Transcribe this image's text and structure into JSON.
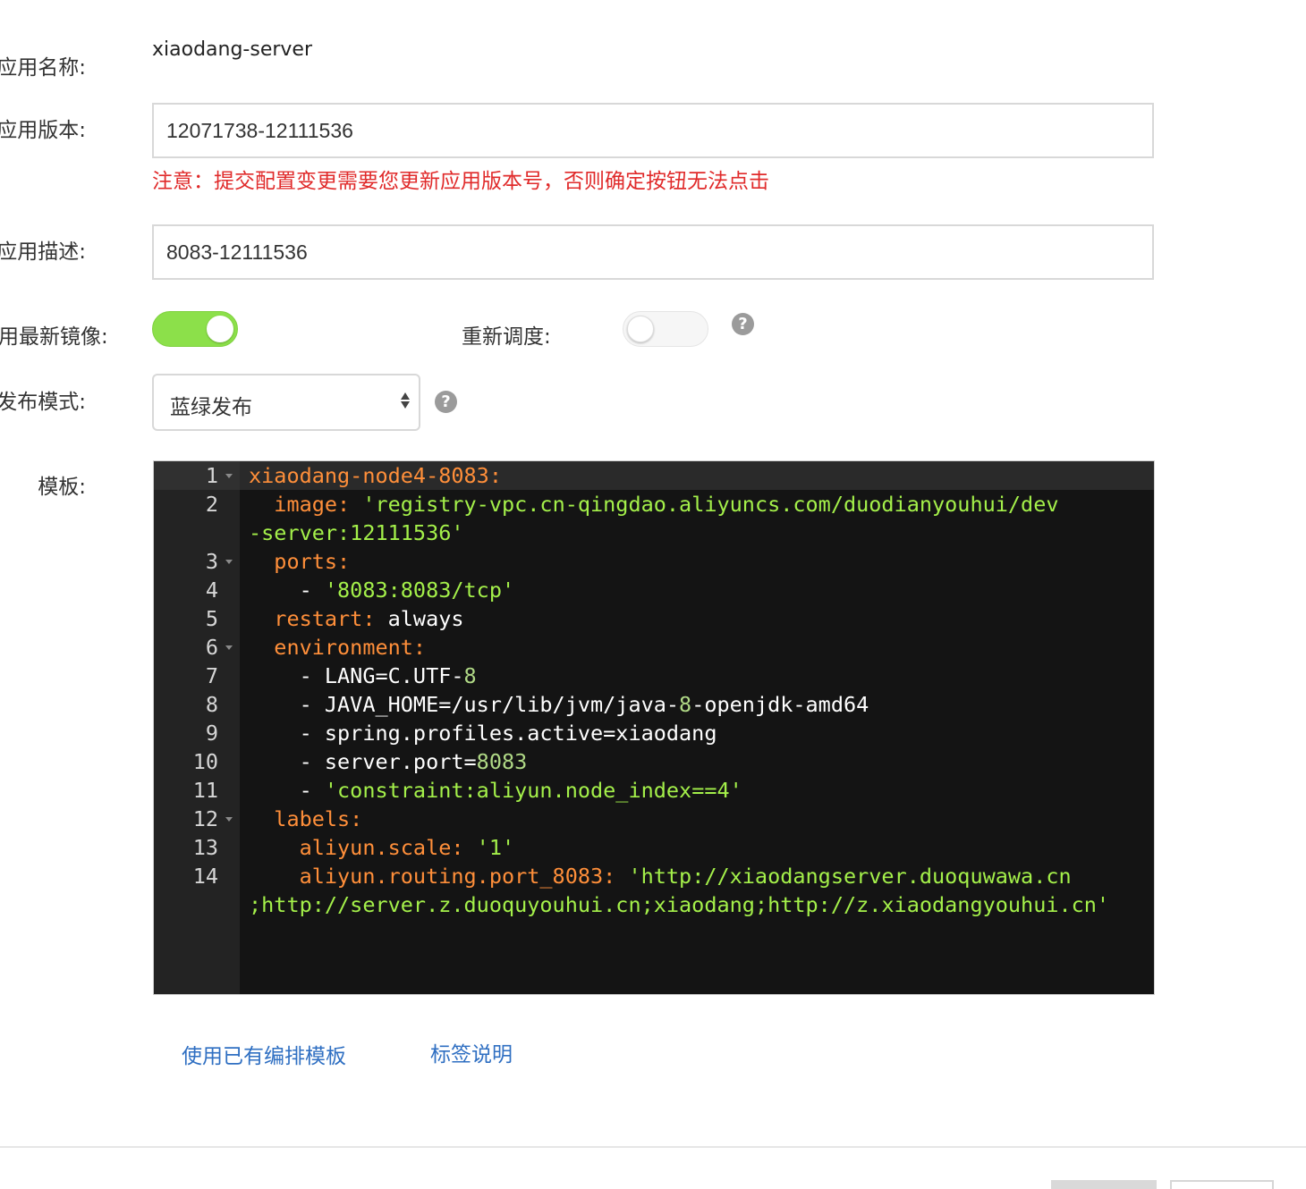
{
  "form": {
    "app_name_label": "应用名称:",
    "app_name_value": "xiaodang-server",
    "app_version_label": "应用版本:",
    "app_version_value": "12071738-12111536",
    "version_warning": "注意：提交配置变更需要您更新应用版本号，否则确定按钮无法点击",
    "app_desc_label": "应用描述:",
    "app_desc_value": "8083-12111536",
    "use_latest_image_label": "用最新镜像:",
    "use_latest_image_on": true,
    "reschedule_label": "重新调度:",
    "reschedule_on": false,
    "release_mode_label": "发布模式:",
    "release_mode_value": "蓝绿发布",
    "template_label": "模板:",
    "help_glyph": "?"
  },
  "editor": {
    "line_numbers": [
      "1",
      "2",
      "3",
      "4",
      "5",
      "6",
      "7",
      "8",
      "9",
      "10",
      "11",
      "12",
      "13",
      "14"
    ],
    "lines": {
      "l1": "xiaodang-node4-8083:",
      "l2_key": "  image: ",
      "l2_val": "'registry-vpc.cn-qingdao.aliyuncs.com/duodianyouhui/dev",
      "l2_wrap": "-server:12111536'",
      "l3": "  ports:",
      "l4_dash": "    - ",
      "l4_val": "'8083:8083/tcp'",
      "l5_key": "  restart: ",
      "l5_val": "always",
      "l6": "  environment:",
      "l7_a": "    - LANG=C.UTF-",
      "l7_b": "8",
      "l8_a": "    - JAVA_HOME=/usr/lib/jvm/java-",
      "l8_b": "8",
      "l8_c": "-openjdk-amd64",
      "l9": "    - spring.profiles.active=xiaodang",
      "l10_a": "    - server.port=",
      "l10_b": "8083",
      "l11_dash": "    - ",
      "l11_val": "'constraint:aliyun.node_index==4'",
      "l12": "  labels:",
      "l13_key": "    aliyun.scale: ",
      "l13_val": "'1'",
      "l14_key": "    aliyun.routing.port_8083: ",
      "l14_val": "'http://xiaodangserver.duoquwawa.cn",
      "l14_wrap": ";http://server.z.duoquyouhui.cn;xiaodang;http://z.xiaodangyouhui.cn'"
    },
    "colors": {
      "background": "#141414",
      "key": "#ff8f3a",
      "string": "#a4f04a",
      "number": "#b0d986"
    }
  },
  "links": {
    "use_existing_template": "使用已有编排模板",
    "label_docs": "标签说明"
  },
  "colors": {
    "toggle_on": "#8ce04a",
    "warning": "#e02a2a",
    "link": "#2f6fc2"
  }
}
